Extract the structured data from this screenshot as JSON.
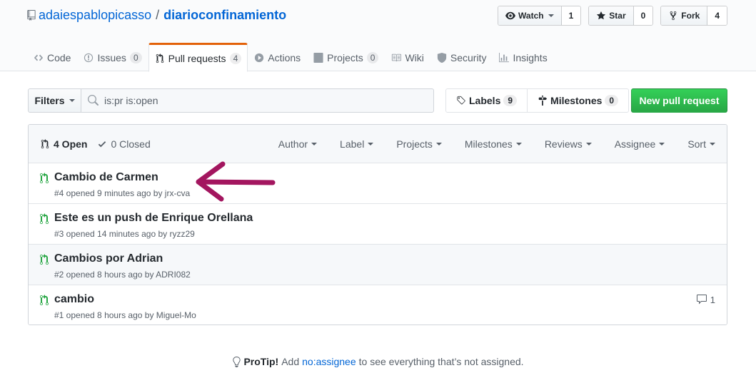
{
  "repo": {
    "owner": "adaiespablopicasso",
    "separator": "/",
    "name": "diarioconfinamiento"
  },
  "actions": [
    {
      "icon": "eye-icon",
      "label": "Watch",
      "count": "1"
    },
    {
      "icon": "star-icon",
      "label": "Star",
      "count": "0"
    },
    {
      "icon": "fork-icon",
      "label": "Fork",
      "count": "4"
    }
  ],
  "tabs": [
    {
      "label": "Code",
      "icon": "code-icon"
    },
    {
      "label": "Issues",
      "icon": "issue-icon",
      "count": "0"
    },
    {
      "label": "Pull requests",
      "icon": "pull-request-icon",
      "count": "4"
    },
    {
      "label": "Actions",
      "icon": "play-icon"
    },
    {
      "label": "Projects",
      "icon": "project-icon",
      "count": "0"
    },
    {
      "label": "Wiki",
      "icon": "book-icon"
    },
    {
      "label": "Security",
      "icon": "shield-icon"
    },
    {
      "label": "Insights",
      "icon": "graph-icon"
    }
  ],
  "subnav": {
    "filters_label": "Filters",
    "search_value": "is:pr is:open",
    "labels_label": "Labels",
    "labels_count": "9",
    "milestones_label": "Milestones",
    "milestones_count": "0",
    "new_pr_label": "New pull request"
  },
  "list_header": {
    "open_label": "4 Open",
    "closed_label": "0 Closed",
    "menus": [
      "Author",
      "Label",
      "Projects",
      "Milestones",
      "Reviews",
      "Assignee",
      "Sort"
    ]
  },
  "pull_requests": [
    {
      "title": "Cambio de Carmen",
      "meta": "#4 opened 9 minutes ago by jrx-cva",
      "comments": ""
    },
    {
      "title": "Este es un push de Enrique Orellana",
      "meta": "#3 opened 14 minutes ago by ryzz29",
      "comments": ""
    },
    {
      "title": "Cambios por Adrian",
      "meta": "#2 opened 8 hours ago by ADRI082",
      "comments": ""
    },
    {
      "title": "cambio",
      "meta": "#1 opened 8 hours ago by Miguel-Mo",
      "comments": "1"
    }
  ],
  "protip": {
    "strong": "ProTip!",
    "before": "Add",
    "link": "no:assignee",
    "after": "to see everything that’s not assigned."
  },
  "colors": {
    "accent": "#0366d6",
    "green": "#28a745",
    "tab_highlight": "#e36209",
    "arrow": "#a3165f"
  }
}
